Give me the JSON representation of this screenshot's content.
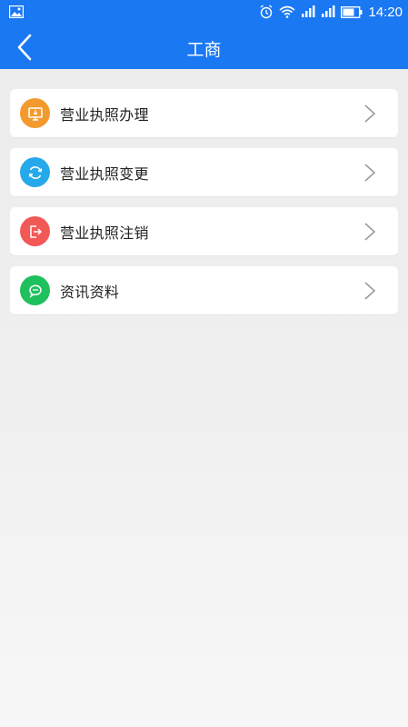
{
  "status_bar": {
    "time": "14:20",
    "icons": [
      "image-icon",
      "alarm-icon",
      "wifi-icon",
      "signal-icon",
      "signal-icon",
      "battery-icon"
    ]
  },
  "header": {
    "title": "工商",
    "back_icon": "chevron-left-icon"
  },
  "colors": {
    "primary": "#1a78f2",
    "orange": "#f39a2f",
    "blue": "#26a9ea",
    "red": "#f25856",
    "green": "#1fc05e"
  },
  "menu": {
    "items": [
      {
        "label": "营业执照办理",
        "icon": "monitor-icon",
        "color": "#f39a2f"
      },
      {
        "label": "营业执照变更",
        "icon": "refresh-icon",
        "color": "#26a9ea"
      },
      {
        "label": "营业执照注销",
        "icon": "logout-icon",
        "color": "#f25856"
      },
      {
        "label": "资讯资料",
        "icon": "chat-icon",
        "color": "#1fc05e"
      }
    ]
  }
}
